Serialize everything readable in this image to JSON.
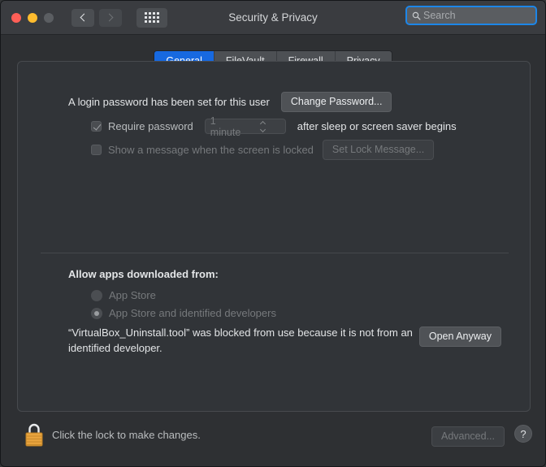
{
  "window": {
    "title": "Security & Privacy",
    "traffic_lights": [
      "close",
      "minimize",
      "zoom"
    ],
    "nav": {
      "back": "back-chevron",
      "forward": "forward-chevron"
    },
    "grid_button": "show-all-preferences"
  },
  "search": {
    "placeholder": "Search",
    "value": "",
    "icon": "search-icon",
    "focus_color": "#1d86e8"
  },
  "tabs": [
    {
      "label": "General",
      "active": true
    },
    {
      "label": "FileVault",
      "active": false
    },
    {
      "label": "Firewall",
      "active": false
    },
    {
      "label": "Privacy",
      "active": false
    }
  ],
  "general": {
    "login_password_text": "A login password has been set for this user",
    "change_password_button": "Change Password...",
    "require_password": {
      "checked": true,
      "label": "Require password",
      "delay_value": "1 minute",
      "trailing_text": "after sleep or screen saver begins"
    },
    "lock_message": {
      "checked": false,
      "label": "Show a message when the screen is locked",
      "button": "Set Lock Message..."
    },
    "allow_apps_heading": "Allow apps downloaded from:",
    "sources": [
      {
        "label": "App Store",
        "selected": false
      },
      {
        "label": "App Store and identified developers",
        "selected": true
      }
    ],
    "blocked_notice": "“VirtualBox_Uninstall.tool” was blocked from use because it is not from an identified developer.",
    "open_anyway_button": "Open Anyway"
  },
  "footer": {
    "lock_icon": "closed-padlock-icon",
    "lock_text": "Click the lock to make changes.",
    "advanced_button": "Advanced...",
    "help_button": "?"
  },
  "colors": {
    "accent_blue": "#1769e0",
    "window_bg": "#2e3033",
    "titlebar_bg": "#3a3c40",
    "panel_bg": "#313438",
    "lock_gold": "#e8a33d"
  }
}
